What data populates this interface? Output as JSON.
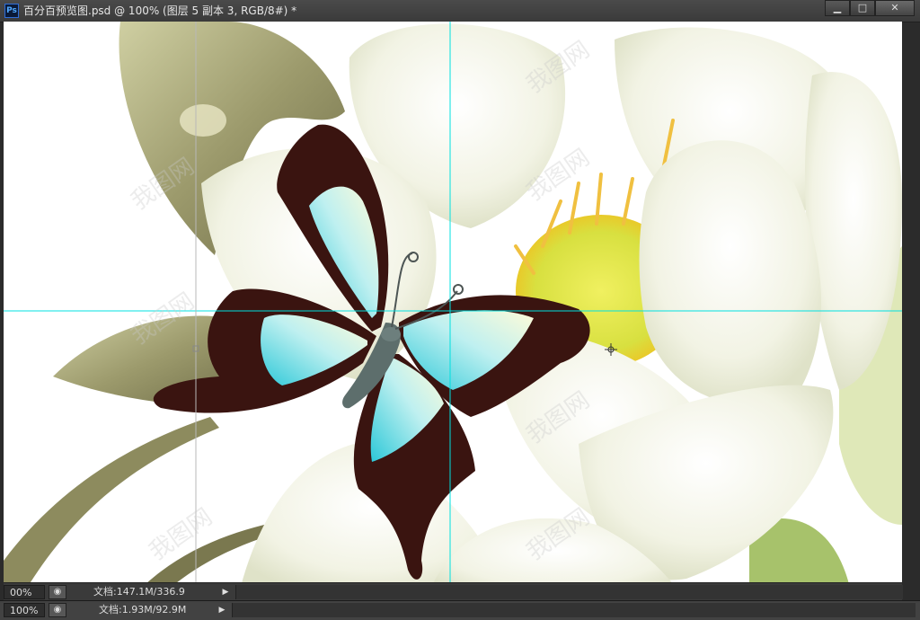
{
  "window": {
    "app_icon_text": "Ps",
    "title": "百分百预览图.psd @ 100% (图层 5 副本 3, RGB/8#) *",
    "minimize_glyph": "▁",
    "maximize_glyph": "□",
    "close_glyph": "✕"
  },
  "inner_status": {
    "zoom": "00%",
    "info_icon": "◉",
    "doc_info": "文档:147.1M/336.9",
    "arrow": "▶"
  },
  "outer_status": {
    "zoom": "100%",
    "info_icon": "◉",
    "doc_info": "文档:1.93M/92.9M",
    "arrow": "▶"
  },
  "watermark": "我图网",
  "colors": {
    "guide": "#00e0e0",
    "canvas_bg": "#ffffff",
    "chrome_dark": "#2b2b2b"
  }
}
